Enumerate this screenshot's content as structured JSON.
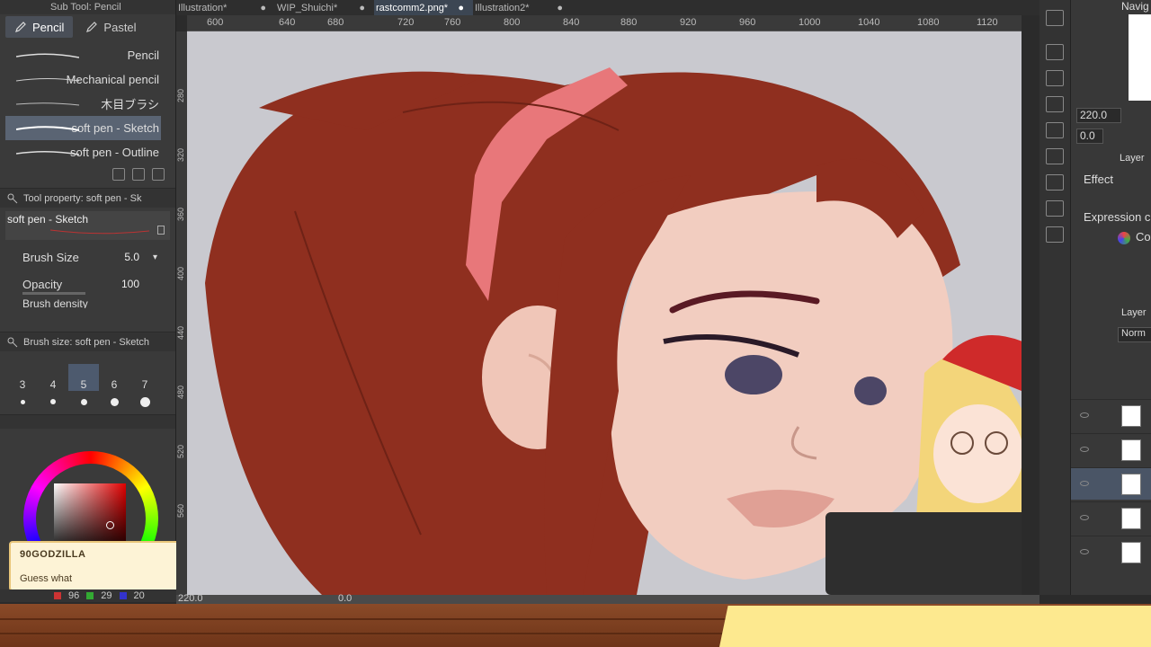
{
  "subtool": {
    "title": "Sub Tool: Pencil",
    "tabs": [
      {
        "label": "Pencil"
      },
      {
        "label": "Pastel"
      }
    ],
    "brushes": [
      {
        "label": "Pencil"
      },
      {
        "label": "Mechanical pencil"
      },
      {
        "label": "木目ブラシ"
      },
      {
        "label": "soft pen - Sketch",
        "selected": true
      },
      {
        "label": "soft pen - Outline"
      }
    ]
  },
  "tool_property": {
    "title": "Tool property: soft pen - Sk",
    "preset": "soft pen - Sketch",
    "brush_size_label": "Brush Size",
    "brush_size_value": "5.0",
    "opacity_label": "Opacity",
    "opacity_value": "100",
    "density_label": "Brush density"
  },
  "brush_size": {
    "title": "Brush size: soft pen - Sketch",
    "sizes": [
      "3",
      "4",
      "5",
      "6",
      "7"
    ],
    "selected": "5"
  },
  "chat": {
    "user": "90GODZILLA",
    "message": "Guess what"
  },
  "color_readout": {
    "r": "96",
    "g": "29",
    "b": "20"
  },
  "documents": [
    {
      "label": "Illustration*"
    },
    {
      "label": "WIP_Shuichi*"
    },
    {
      "label": "rastcomm2.png*",
      "active": true
    },
    {
      "label": "Illustration2*"
    }
  ],
  "ruler": {
    "h": [
      "600",
      "640",
      "680",
      "720",
      "760",
      "800",
      "840",
      "880",
      "920",
      "960",
      "1000",
      "1040",
      "1080",
      "1120"
    ],
    "v": [
      "280",
      "320",
      "360",
      "400",
      "440",
      "480",
      "520",
      "560"
    ]
  },
  "navigator": {
    "title": "Navig",
    "zoom": "220.0",
    "angle": "0.0"
  },
  "layer_property": {
    "title": "Layer",
    "effect_label": "Effect",
    "expression_label": "Expression c",
    "color_label": "Color"
  },
  "layers": {
    "title": "Layer",
    "blend": "Norm"
  },
  "status": {
    "zoom": "220.0",
    "angle": "0.0"
  },
  "colors": {
    "hair": "#8f2f1f",
    "ribbon": "#e8777a",
    "skin": "#f2cdc0",
    "accent": "#3c4653"
  }
}
